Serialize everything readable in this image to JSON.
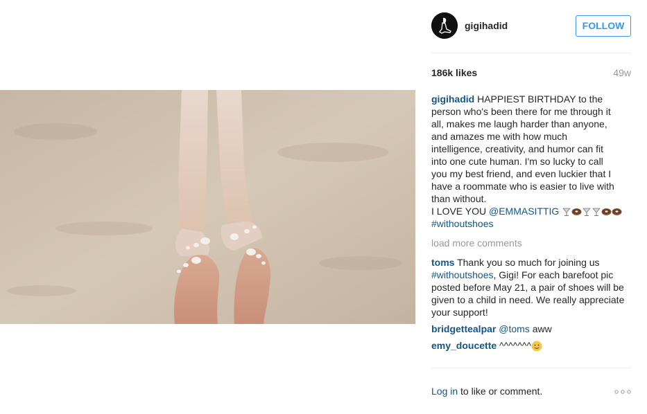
{
  "post": {
    "author": "gigihadid",
    "follow_label": "FOLLOW",
    "likes": "186k likes",
    "age": "49w",
    "caption": {
      "username": "gigihadid",
      "lines": [
        "HAPPIEST BIRTHDAY to the",
        "person who's been there for me through it",
        "all, makes me laugh harder than anyone,",
        "and amazes me with how much",
        "intelligence, creativity, and humor can fit",
        "into one cute human. I'm so lucky to call",
        "you my best friend, and even luckier that I",
        "have a roommate who is easier to live with",
        "than without."
      ],
      "love_text": "I LOVE YOU",
      "mention": "@EMMASITTIG",
      "emoji": [
        "martini-glass-icon",
        "donut-icon",
        "martini-glass-icon",
        "martini-glass-icon",
        "donut-icon",
        "donut-icon"
      ],
      "hashtag": "#withoutshoes"
    },
    "load_more": "load more comments",
    "comments": [
      {
        "username": "toms",
        "text_before": "Thank you so much for joining us",
        "hashtag": "#withoutshoes",
        "text_after": ", Gigi! For each barefoot pic posted before May 21, a pair of shoes will be given to a child in need. We really appreciate your support!"
      },
      {
        "username": "bridgettealpar",
        "mention": "@toms",
        "text": "aww"
      },
      {
        "username": "emy_doucette",
        "text": "^^^^^^^",
        "emoji": "smiling-face-icon"
      }
    ],
    "footer": {
      "login": "Log in",
      "rest": "to like or comment."
    }
  },
  "colors": {
    "link": "#125688",
    "follow": "#3897f0",
    "muted": "#999999",
    "sand": "#c9b9a7"
  }
}
